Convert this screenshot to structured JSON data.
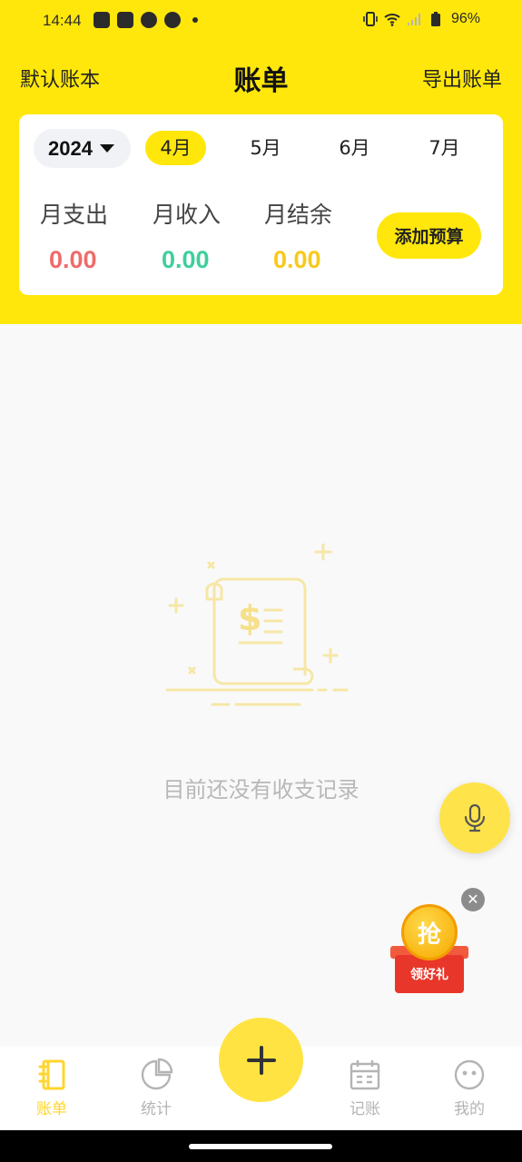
{
  "status_bar": {
    "time": "14:44",
    "battery": "96%",
    "icons": [
      "shopping-bag-icon",
      "shopping-bag-icon",
      "speedometer-icon",
      "speedometer-icon",
      "dot-icon",
      "vibrate-icon",
      "wifi-icon",
      "signal-icon",
      "battery-icon"
    ]
  },
  "header": {
    "left_label": "默认账本",
    "title": "账单",
    "right_label": "导出账单"
  },
  "summary_card": {
    "year": "2024",
    "months": [
      "4月",
      "5月",
      "6月",
      "7月"
    ],
    "selected_month": "4月",
    "stats": [
      {
        "label": "月支出",
        "value": "0.00",
        "color": "#ef6b6b"
      },
      {
        "label": "月收入",
        "value": "0.00",
        "color": "#3ecf9b"
      },
      {
        "label": "月结余",
        "value": "0.00",
        "color": "#f7c91a"
      }
    ],
    "budget_button": "添加预算"
  },
  "empty_state": {
    "message": "目前还没有收支记录",
    "icon": "receipt-icon"
  },
  "floating": {
    "mic_icon": "microphone-icon",
    "promo_coin_text": "抢",
    "promo_label": "领好礼",
    "close_icon": "close-icon"
  },
  "bottom_nav": {
    "items": [
      {
        "label": "账单",
        "icon": "notebook-icon",
        "active": true
      },
      {
        "label": "统计",
        "icon": "pie-chart-icon",
        "active": false
      },
      {
        "label": "记账",
        "icon": "calendar-icon",
        "active": false
      },
      {
        "label": "我的",
        "icon": "face-icon",
        "active": false
      }
    ],
    "add_icon": "plus-icon"
  },
  "colors": {
    "brand_yellow": "#ffe70b",
    "inactive_nav": "#b4b4b4",
    "active_nav": "#ffd52e"
  }
}
